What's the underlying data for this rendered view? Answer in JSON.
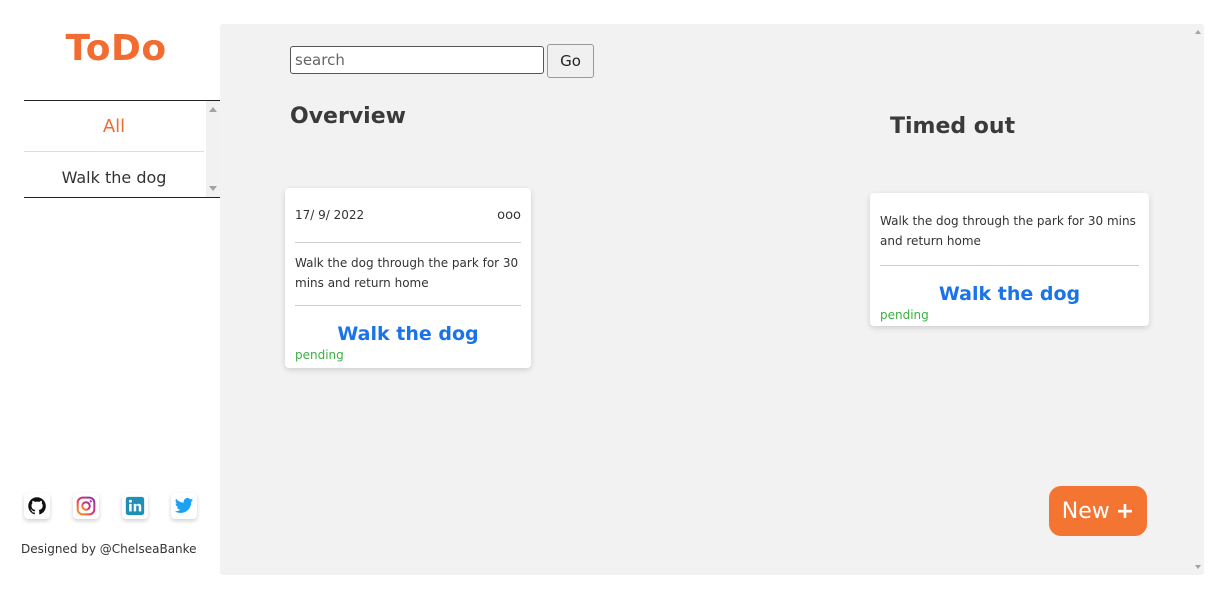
{
  "app": {
    "title": "ToDo"
  },
  "sidebar": {
    "items": [
      {
        "label": "All",
        "active": true
      },
      {
        "label": "Walk the dog",
        "active": false
      }
    ],
    "socials": [
      "github-icon",
      "instagram-icon",
      "linkedin-icon",
      "twitter-icon"
    ],
    "credit": "Designed by @ChelseaBanke"
  },
  "search": {
    "placeholder": "search",
    "value": "",
    "button_label": "Go"
  },
  "sections": {
    "overview": "Overview",
    "timed_out": "Timed out"
  },
  "overview_cards": [
    {
      "date": "17/ 9/ 2022",
      "menu": "ooo",
      "description": "Walk the dog through the park for 30 mins and return home",
      "title": "Walk the dog",
      "status": "pending"
    }
  ],
  "timed_out_cards": [
    {
      "description": "Walk the dog through the park for 30 mins and return home",
      "title": "Walk the dog",
      "status": "pending"
    }
  ],
  "new_button": {
    "label": "New",
    "icon": "plus-icon"
  },
  "colors": {
    "accent": "#f26b30",
    "title_blue": "#1a73e8",
    "status_green": "#3cb043",
    "panel_bg": "#f2f2f2"
  }
}
